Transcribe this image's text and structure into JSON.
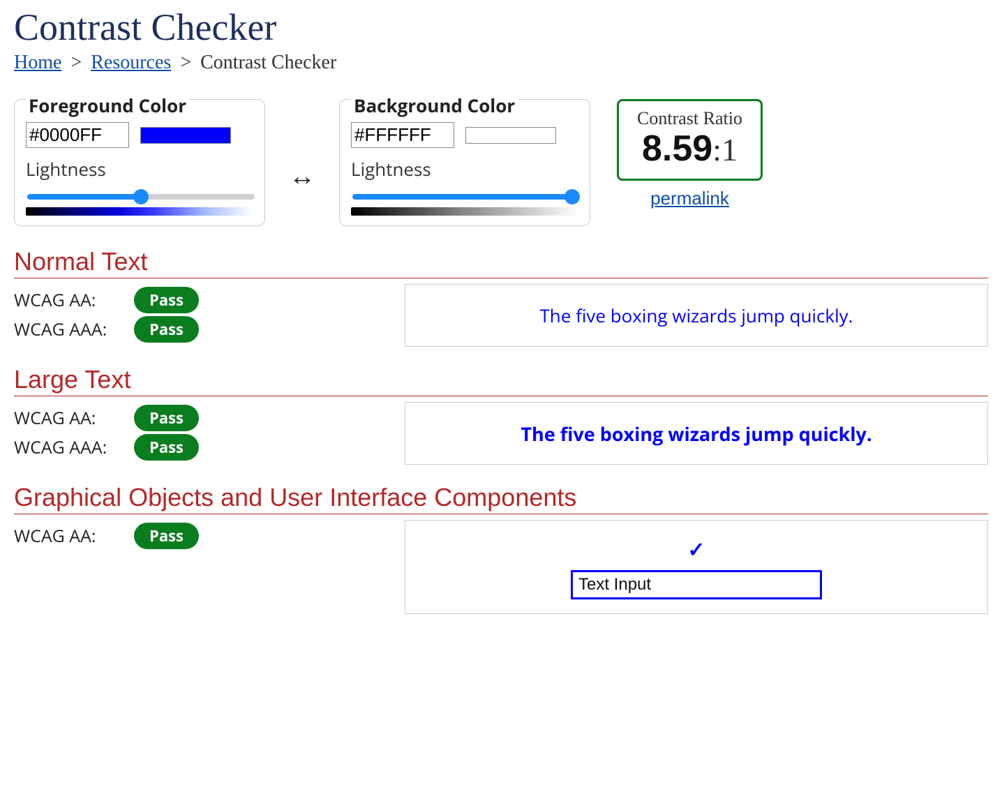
{
  "page": {
    "title": "Contrast Checker"
  },
  "breadcrumb": {
    "home": "Home",
    "resources": "Resources",
    "current": "Contrast Checker",
    "sep": ">"
  },
  "foreground": {
    "legend": "Foreground Color",
    "hex": "#0000FF",
    "swatch_color": "#0000FF",
    "lightness_label": "Lightness",
    "lightness_value": 50
  },
  "background": {
    "legend": "Background Color",
    "hex": "#FFFFFF",
    "swatch_color": "#FFFFFF",
    "lightness_label": "Lightness",
    "lightness_value": 100
  },
  "ratio": {
    "title": "Contrast Ratio",
    "value_bold": "8.59",
    "value_suffix": ":1",
    "permalink": "permalink"
  },
  "sections": {
    "normal": {
      "heading": "Normal Text",
      "aa_label": "WCAG AA:",
      "aa_result": "Pass",
      "aaa_label": "WCAG AAA:",
      "aaa_result": "Pass",
      "sample": "The five boxing wizards jump quickly."
    },
    "large": {
      "heading": "Large Text",
      "aa_label": "WCAG AA:",
      "aa_result": "Pass",
      "aaa_label": "WCAG AAA:",
      "aaa_result": "Pass",
      "sample": "The five boxing wizards jump quickly."
    },
    "ui": {
      "heading": "Graphical Objects and User Interface Components",
      "aa_label": "WCAG AA:",
      "aa_result": "Pass",
      "input_value": "Text Input"
    }
  }
}
